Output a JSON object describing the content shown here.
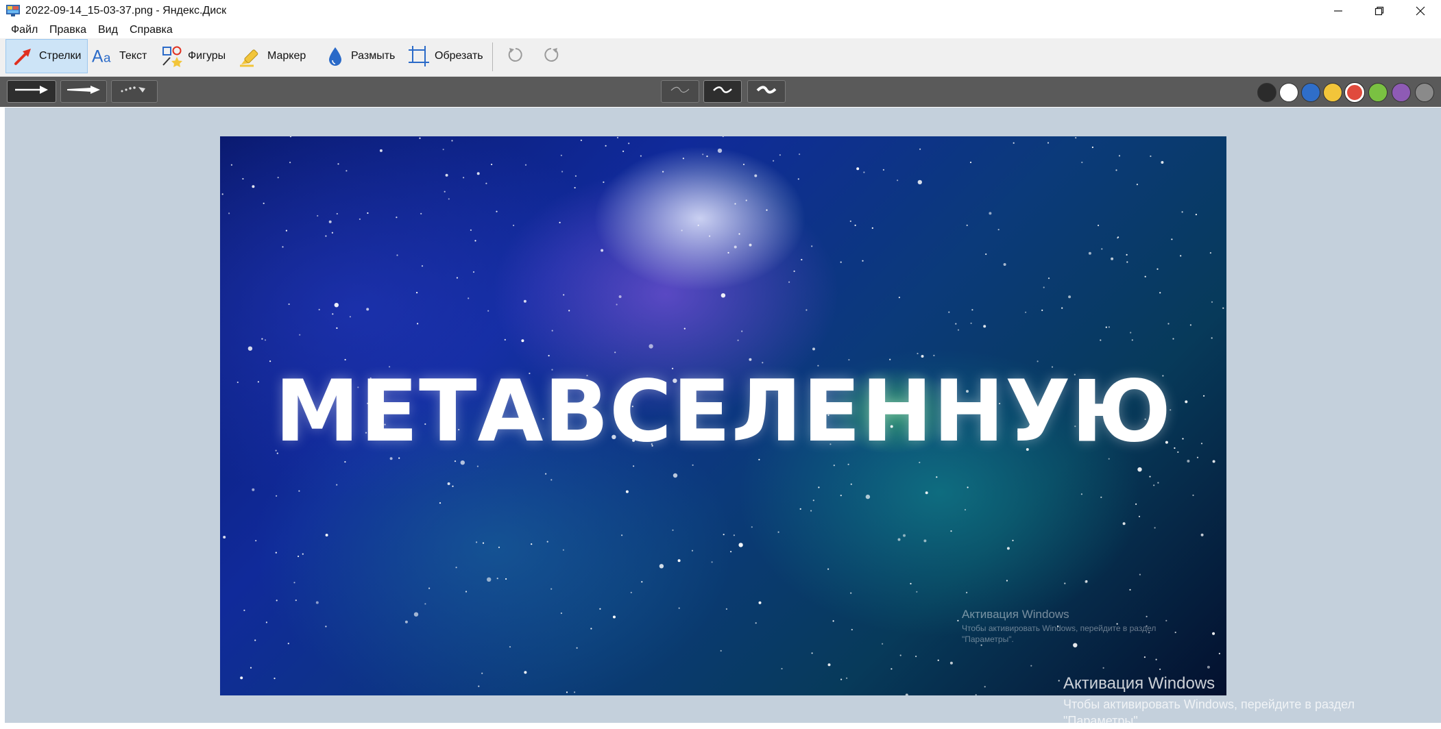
{
  "window": {
    "title": "2022-09-14_15-03-37.png - Яндекс.Диск",
    "icon": "yandex-disk-app-icon",
    "controls": [
      "minimize-icon",
      "restore-icon",
      "close-icon"
    ]
  },
  "menu": {
    "items": [
      {
        "label": "Файл"
      },
      {
        "label": "Правка"
      },
      {
        "label": "Вид"
      },
      {
        "label": "Справка"
      }
    ]
  },
  "toolbar": {
    "tools": [
      {
        "label": "Стрелки",
        "icon": "arrow-icon",
        "active": true
      },
      {
        "label": "Текст",
        "icon": "text-icon",
        "active": false
      },
      {
        "label": "Фигуры",
        "icon": "shapes-icon",
        "active": false
      },
      {
        "label": "Маркер",
        "icon": "marker-icon",
        "active": false
      },
      {
        "label": "Размыть",
        "icon": "blur-drop-icon",
        "active": false
      },
      {
        "label": "Обрезать",
        "icon": "crop-icon",
        "active": false
      }
    ],
    "history": [
      "undo-icon",
      "redo-icon"
    ]
  },
  "options": {
    "arrow_styles": [
      "straight-arrow",
      "tapered-arrow",
      "dotted-arrow"
    ],
    "selected_arrow_style": 0,
    "line_widths": [
      "thin",
      "medium",
      "thick"
    ],
    "selected_line_width": 1,
    "colors": [
      "#2b2b2b",
      "#ffffff",
      "#2f6ec9",
      "#f2c53a",
      "#e04a3c",
      "#7ac142",
      "#8e5bb5",
      "#8a8a8a"
    ],
    "selected_color": 4
  },
  "image": {
    "headline": "МЕТАВСЕЛЕННУЮ",
    "watermark_title": "Активация Windows",
    "watermark_line1": "Чтобы активировать Windows, перейдите в раздел",
    "watermark_line2": "\"Параметры\"."
  },
  "watermark": {
    "title": "Активация Windows",
    "line1": "Чтобы активировать Windows, перейдите в раздел",
    "line2": "\"Параметры\"."
  }
}
